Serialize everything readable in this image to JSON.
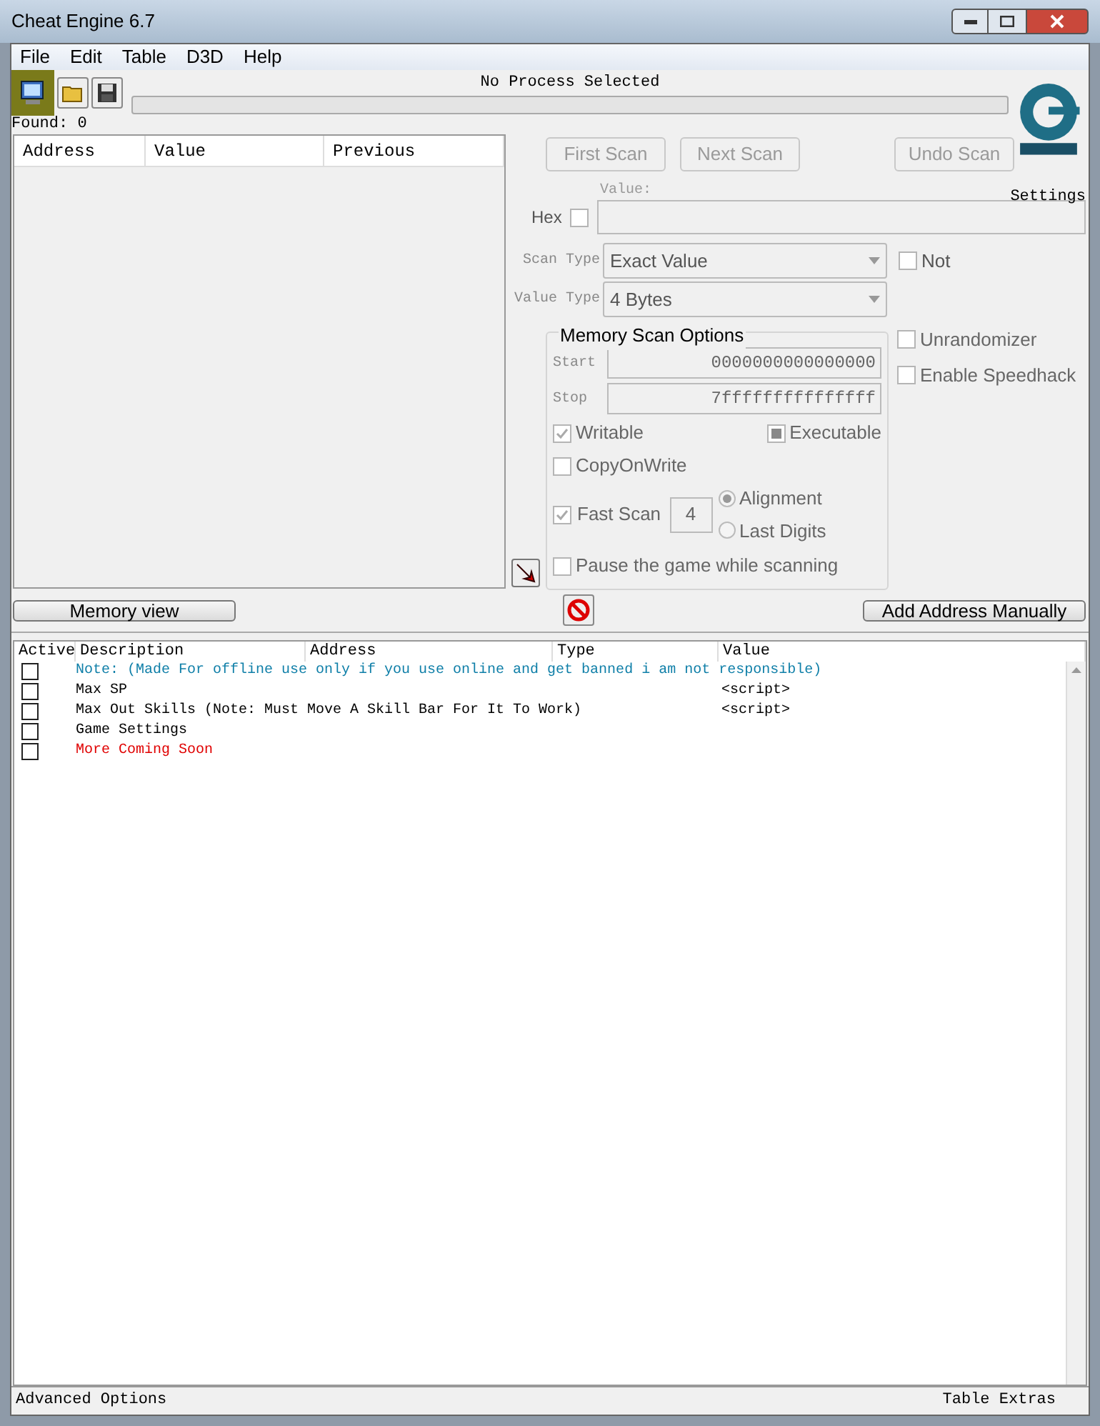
{
  "window": {
    "title": "Cheat Engine 6.7"
  },
  "menu": [
    "File",
    "Edit",
    "Table",
    "D3D",
    "Help"
  ],
  "process": {
    "label": "No Process Selected",
    "level": 0
  },
  "found": "Found: 0",
  "results_table": {
    "columns": [
      "Address",
      "Value",
      "Previous"
    ]
  },
  "scan_buttons": [
    {
      "label": "First Scan",
      "disabled": true
    },
    {
      "label": "Next Scan",
      "disabled": true
    },
    {
      "label": "Undo Scan",
      "disabled": true
    }
  ],
  "settings_label": "Settings",
  "value_field": {
    "label": "Value:",
    "hex_label": "Hex",
    "hex_checked": false
  },
  "scan_type": {
    "label": "Scan Type",
    "value": "Exact Value",
    "not_label": "Not",
    "not_checked": false
  },
  "value_type": {
    "label": "Value Type",
    "value": "4 Bytes"
  },
  "memory_options": {
    "title": "Memory Scan Options",
    "start_label": "Start",
    "start": "0000000000000000",
    "stop_label": "Stop",
    "stop": "7fffffffffffffff",
    "writable": {
      "label": "Writable",
      "checked": true
    },
    "executable": {
      "label": "Executable",
      "checked": false,
      "mixed": true
    },
    "copy_on_write": {
      "label": "CopyOnWrite",
      "checked": false
    },
    "fast_scan": {
      "label": "Fast Scan",
      "checked": true,
      "value": "4"
    },
    "alignment": [
      {
        "label": "Alignment",
        "selected": true
      },
      {
        "label": "Last Digits",
        "selected": false
      }
    ],
    "pause": {
      "label": "Pause the game while scanning",
      "checked": false
    }
  },
  "extra_options": [
    {
      "label": "Unrandomizer",
      "checked": false
    },
    {
      "label": "Enable Speedhack",
      "checked": false
    }
  ],
  "memory_view_button": "Memory view",
  "add_address_button": "Add Address Manually",
  "cheat_table": {
    "columns": [
      "Active",
      "Description",
      "Address",
      "Type",
      "Value"
    ],
    "rows": [
      {
        "active": false,
        "description": "Note:  (Made For offline use only if you use online and get banned i am not responsible)",
        "color": "#0f7fa8"
      },
      {
        "active": false,
        "description": "Max SP",
        "value": "<script>",
        "color": "#000000"
      },
      {
        "active": false,
        "description": "Max Out Skills (Note: Must Move A Skill Bar For It To Work)",
        "value": "<script>",
        "color": "#000000"
      },
      {
        "active": false,
        "description": "Game Settings",
        "color": "#000000"
      },
      {
        "active": false,
        "description": "More Coming Soon",
        "color": "#e00000"
      }
    ]
  },
  "status_bar": {
    "left": "Advanced Options",
    "right": "Table Extras"
  }
}
